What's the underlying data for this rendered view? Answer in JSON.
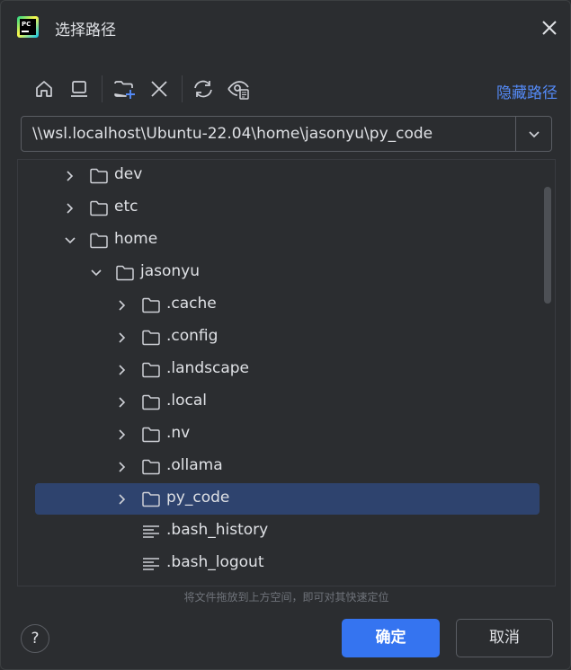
{
  "window": {
    "title": "选择路径",
    "app_logo_text": "PC"
  },
  "toolbar": {
    "hide_path_label": "隐藏路径",
    "icons": [
      "home-icon",
      "desktop-icon",
      "new-folder-icon",
      "delete-icon",
      "refresh-icon",
      "show-hidden-icon"
    ]
  },
  "path": {
    "value": "\\\\wsl.localhost\\Ubuntu-22.04\\home\\jasonyu\\py_code"
  },
  "tree": {
    "items": [
      {
        "label": "dev",
        "level": 0,
        "type": "folder",
        "expanded": false,
        "selected": false
      },
      {
        "label": "etc",
        "level": 0,
        "type": "folder",
        "expanded": false,
        "selected": false
      },
      {
        "label": "home",
        "level": 0,
        "type": "folder",
        "expanded": true,
        "selected": false
      },
      {
        "label": "jasonyu",
        "level": 1,
        "type": "folder",
        "expanded": true,
        "selected": false
      },
      {
        "label": ".cache",
        "level": 2,
        "type": "folder",
        "expanded": false,
        "selected": false
      },
      {
        "label": ".config",
        "level": 2,
        "type": "folder",
        "expanded": false,
        "selected": false
      },
      {
        "label": ".landscape",
        "level": 2,
        "type": "folder",
        "expanded": false,
        "selected": false
      },
      {
        "label": ".local",
        "level": 2,
        "type": "folder",
        "expanded": false,
        "selected": false
      },
      {
        "label": ".nv",
        "level": 2,
        "type": "folder",
        "expanded": false,
        "selected": false
      },
      {
        "label": ".ollama",
        "level": 2,
        "type": "folder",
        "expanded": false,
        "selected": false
      },
      {
        "label": "py_code",
        "level": 2,
        "type": "folder",
        "expanded": false,
        "selected": true
      },
      {
        "label": ".bash_history",
        "level": 2,
        "type": "file",
        "expanded": false,
        "selected": false
      },
      {
        "label": ".bash_logout",
        "level": 2,
        "type": "file",
        "expanded": false,
        "selected": false
      }
    ]
  },
  "footer": {
    "hint": "将文件拖放到上方空间，即可对其快速定位",
    "help_label": "?",
    "ok_label": "确定",
    "cancel_label": "取消"
  },
  "colors": {
    "background": "#2b2d30",
    "accent": "#3574f0",
    "selection": "#2e436e",
    "link": "#548af7",
    "text": "#dfe1e5"
  }
}
